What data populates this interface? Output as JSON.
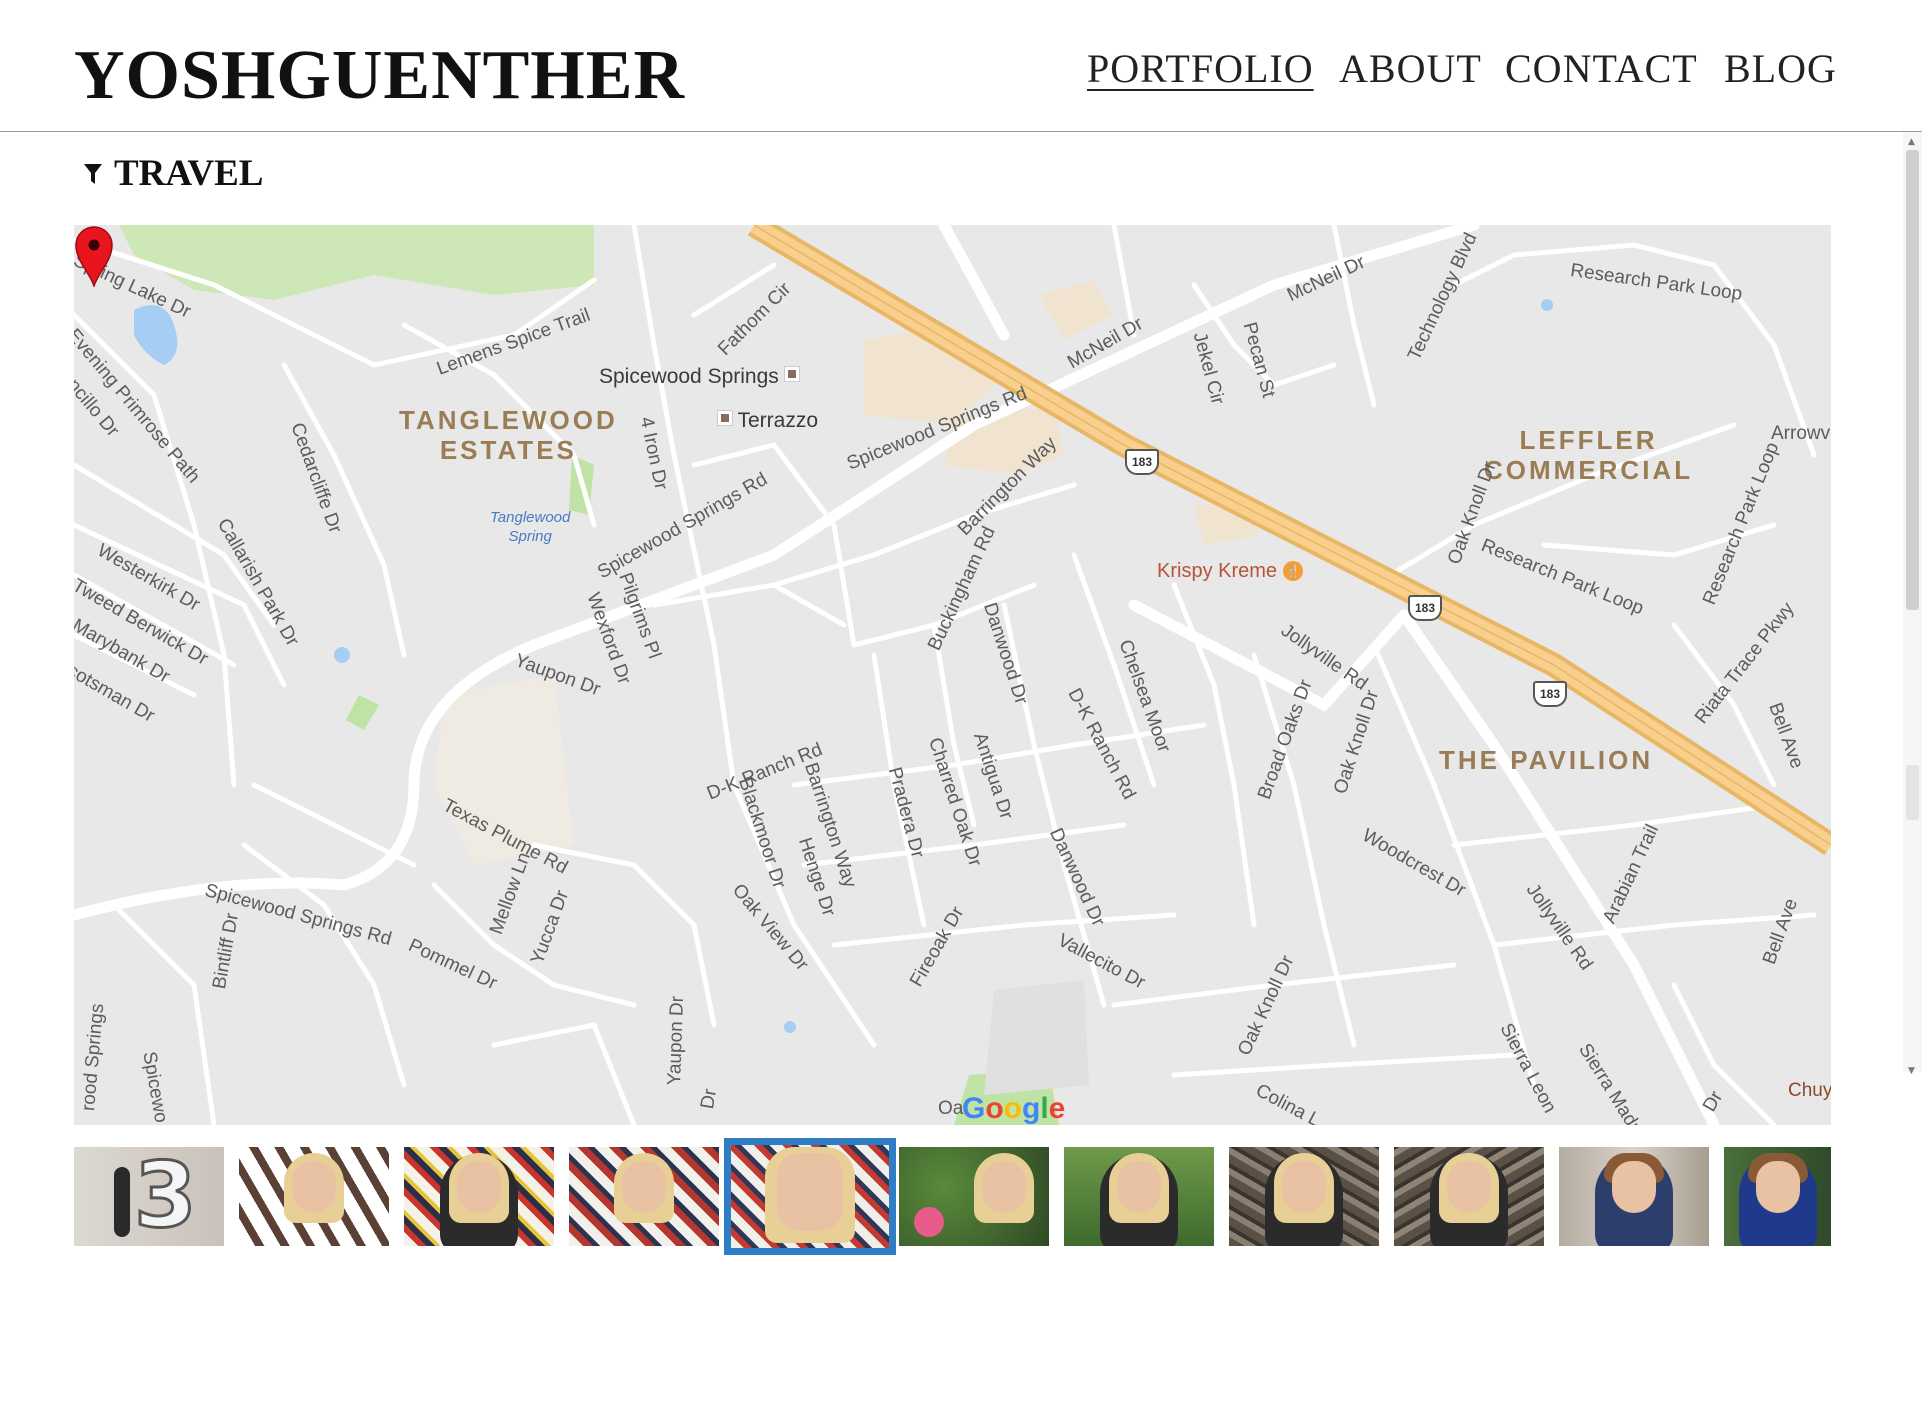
{
  "header": {
    "site_title": "YOSHGUENTHER",
    "nav": [
      {
        "label": "PORTFOLIO",
        "active": true
      },
      {
        "label": "ABOUT",
        "active": false
      },
      {
        "label": "CONTACT",
        "active": false
      },
      {
        "label": "BLOG",
        "active": false
      }
    ]
  },
  "filter": {
    "label": "TRAVEL",
    "icon": "filter-funnel-icon"
  },
  "map": {
    "provider_logo": "Google",
    "areas": [
      "TANGLEWOOD\nESTATES",
      "LEFFLER\nCOMMERCIAL",
      "THE PAVILION"
    ],
    "places": [
      "Spicewood Springs",
      "Terrazzo",
      "Krispy Kreme"
    ],
    "water": "Tanglewood\nSpring",
    "highway_shield": "183",
    "streets": [
      "Spring Lake Dr",
      "Lemens Spice Trail",
      "Fathom Cir",
      "McNeil Dr",
      "Technology Blvd",
      "Research Park Loop",
      "Evening Primrose Path",
      "ncillo Dr",
      "Cedarcliffe Dr",
      "4 Iron Dr",
      "Spicewood Springs Rd",
      "McNeil Dr",
      "Jekel Cir",
      "Pecan St",
      "Arrowv",
      "Callarish Park Dr",
      "Westerkirk Dr",
      "Tweed Berwick Dr",
      "Marybank Dr",
      "cotsman Dr",
      "Spicewood Springs Rd",
      "Barrington Way",
      "Buckingham Rd",
      "Pilgrims Pl",
      "Wexford Dr",
      "Yaupon Dr",
      "Danwood Dr",
      "Chelsea Moor",
      "D-K Ranch Rd",
      "Jollyville Rd",
      "Oak Knoll Dr",
      "Research Park Loop",
      "Research Park Loop",
      "Riata Trace Pkwy",
      "Bell Ave",
      "D-K Ranch Rd",
      "Blackmoor Dr",
      "Barrington Way",
      "Henge Dr",
      "Pradera Dr",
      "Charred Oak Dr",
      "Antigua Dr",
      "Broad Oaks Dr",
      "Oak Knoll Dr",
      "Texas Plume Rd",
      "Mellow Ln",
      "Yucca Dr",
      "Danwood Dr",
      "Woodcrest Dr",
      "Jollyville Rd",
      "Arabian Trail",
      "Spicewood Springs Rd",
      "Bintliff Dr",
      "Pommel Dr",
      "Oak View Dr",
      "Fireoak Dr",
      "Vallecito Dr",
      "Bell Ave",
      "Yaupon Dr",
      "Oak Knoll Dr",
      "Sierra Leon",
      "Sierra Madre",
      "Colina L",
      "Dr",
      "Chuy",
      "Dr",
      "rood Springs",
      "Spicewo",
      "Oa"
    ],
    "colors": {
      "land": "#e8e8e8",
      "road": "#ffffff",
      "highway": "#f6c47a",
      "park": "#c8e6b0",
      "water": "#9ec5f0",
      "marker": "#e8141e"
    }
  },
  "thumbnails": [
    {
      "name": "thumb-1",
      "selected": false
    },
    {
      "name": "thumb-2",
      "selected": false
    },
    {
      "name": "thumb-3",
      "selected": false
    },
    {
      "name": "thumb-4",
      "selected": false
    },
    {
      "name": "thumb-5",
      "selected": true
    },
    {
      "name": "thumb-6",
      "selected": false
    },
    {
      "name": "thumb-7",
      "selected": false
    },
    {
      "name": "thumb-8",
      "selected": false
    },
    {
      "name": "thumb-9",
      "selected": false
    },
    {
      "name": "thumb-10",
      "selected": false
    },
    {
      "name": "thumb-11",
      "selected": false
    }
  ]
}
